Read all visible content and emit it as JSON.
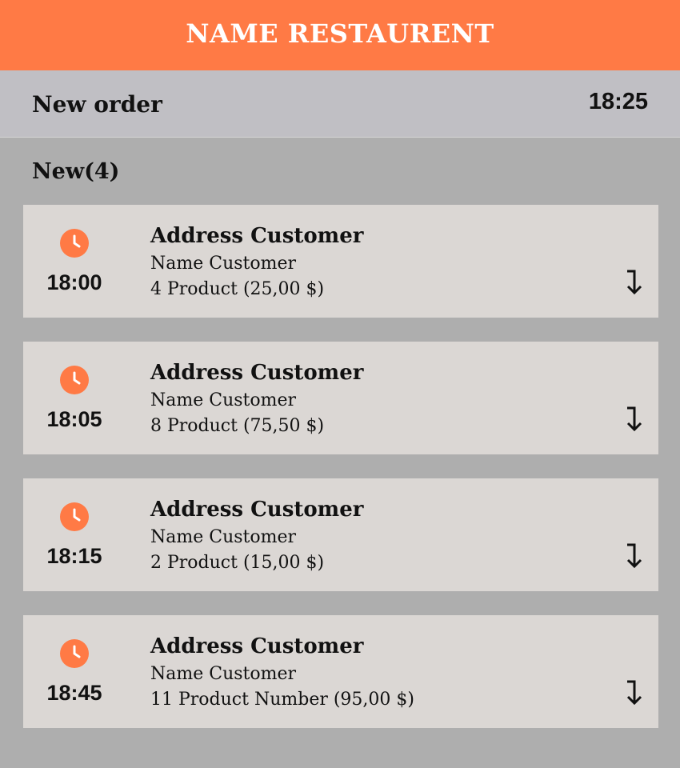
{
  "app": {
    "restaurant_name": "NAME RESTAURENT"
  },
  "header": {
    "title": "New order",
    "current_time": "18:25"
  },
  "section": {
    "label": "New(4)"
  },
  "colors": {
    "accent": "#ff7a45",
    "page_background": "#aeaeae",
    "subheader_background": "#c0bfc4",
    "card_background": "#dbd7d4"
  },
  "icons": {
    "order_time": "clock-icon",
    "expand": "arrow-down-icon"
  },
  "orders": [
    {
      "time": "18:00",
      "address": "Address Customer",
      "customer": "Name Customer",
      "products": "4 Product (25,00 $)"
    },
    {
      "time": "18:05",
      "address": "Address Customer",
      "customer": "Name Customer",
      "products": "8 Product (75,50 $)"
    },
    {
      "time": "18:15",
      "address": "Address Customer",
      "customer": "Name Customer",
      "products": "2 Product (15,00 $)"
    },
    {
      "time": "18:45",
      "address": "Address Customer",
      "customer": "Name Customer",
      "products": "11 Product Number (95,00 $)"
    }
  ]
}
